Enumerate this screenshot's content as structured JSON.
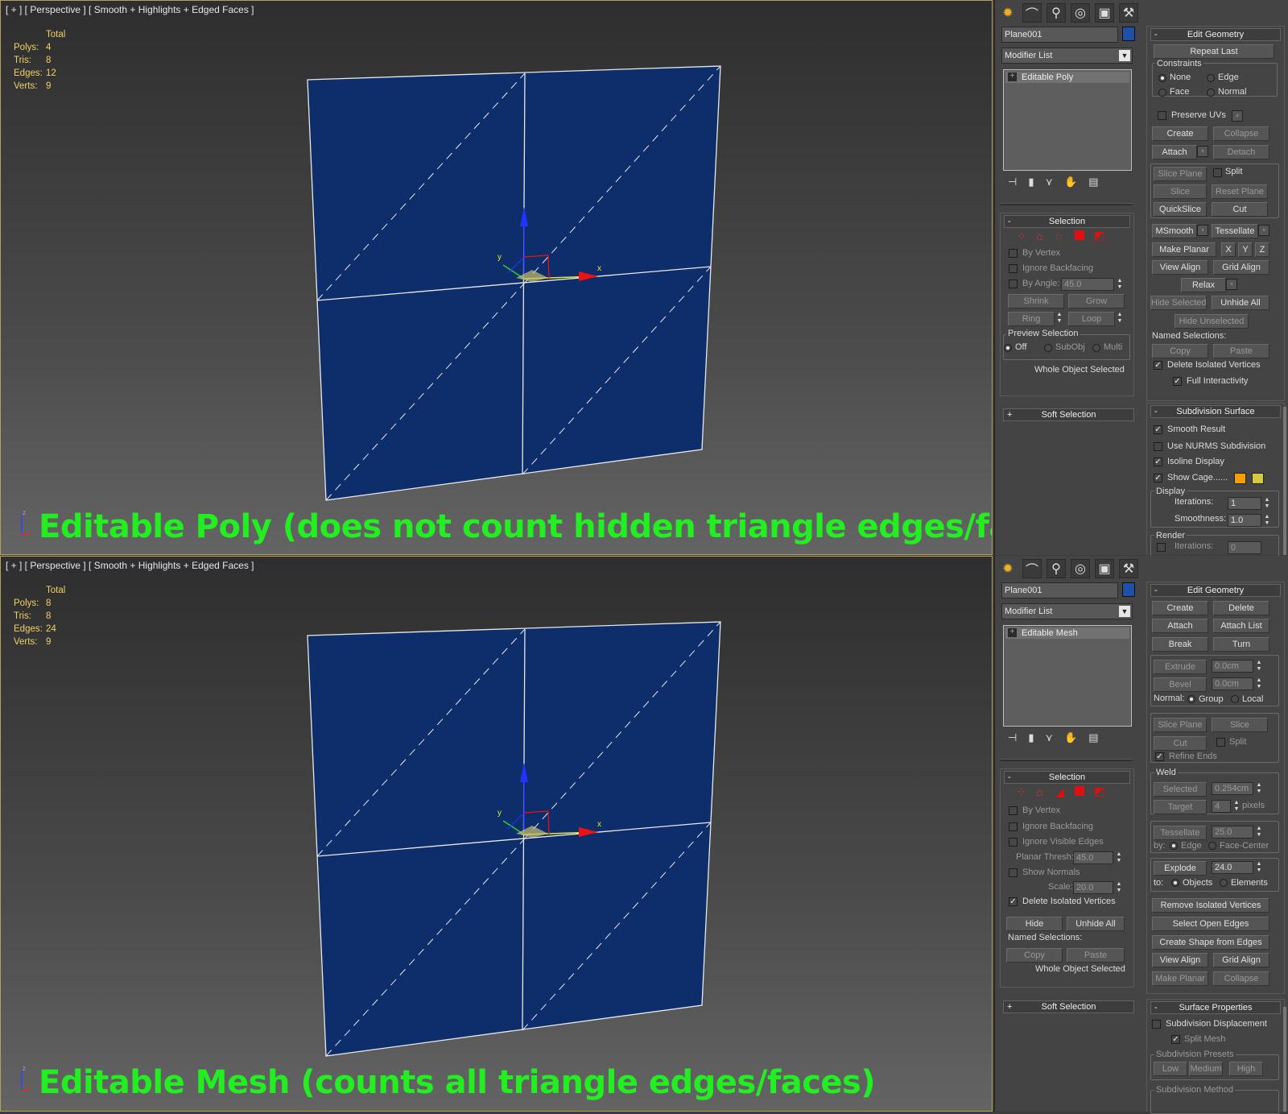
{
  "top": {
    "viewport_label": "[ + ] [ Perspective ] [ Smooth + Highlights + Edged Faces ]",
    "stats_header": "Total",
    "stats": [
      {
        "label": "Polys:",
        "value": "4"
      },
      {
        "label": "Tris:",
        "value": "8"
      },
      {
        "label": "Edges:",
        "value": "12"
      },
      {
        "label": "Verts:",
        "value": "9"
      }
    ],
    "gizmo": {
      "x": "x",
      "y": "y",
      "z": "z"
    },
    "caption": "Editable Poly (does not count hidden triangle edges/faces)",
    "object_name": "Plane001",
    "modifier_list": "Modifier List",
    "stack_item": "Editable Poly",
    "selection": {
      "title": "Selection",
      "by_vertex": "By Vertex",
      "ignore_backfacing": "Ignore Backfacing",
      "by_angle": "By Angle:",
      "angle_value": "45.0",
      "shrink": "Shrink",
      "grow": "Grow",
      "ring": "Ring",
      "loop": "Loop",
      "preview_selection": "Preview Selection",
      "off": "Off",
      "subobj": "SubObj",
      "multi": "Multi",
      "status": "Whole Object Selected"
    },
    "soft_selection": "Soft Selection",
    "edit_geometry": {
      "title": "Edit Geometry",
      "repeat_last": "Repeat Last",
      "constraints": "Constraints",
      "none": "None",
      "edge": "Edge",
      "face": "Face",
      "normal": "Normal",
      "preserve_uvs": "Preserve UVs",
      "create": "Create",
      "collapse": "Collapse",
      "attach": "Attach",
      "detach": "Detach",
      "slice_plane": "Slice Plane",
      "split": "Split",
      "slice": "Slice",
      "reset_plane": "Reset Plane",
      "quickslice": "QuickSlice",
      "cut": "Cut",
      "msmooth": "MSmooth",
      "tessellate": "Tessellate",
      "make_planar": "Make Planar",
      "x": "X",
      "y": "Y",
      "z": "Z",
      "view_align": "View Align",
      "grid_align": "Grid Align",
      "relax": "Relax",
      "hide_selected": "Hide Selected",
      "unhide_all": "Unhide All",
      "hide_unselected": "Hide Unselected",
      "named_selections": "Named Selections:",
      "copy": "Copy",
      "paste": "Paste",
      "delete_isolated": "Delete Isolated Vertices",
      "full_interactivity": "Full Interactivity"
    },
    "subdivision": {
      "title": "Subdivision Surface",
      "smooth_result": "Smooth Result",
      "use_nurms": "Use NURMS Subdivision",
      "isoline": "Isoline Display",
      "show_cage": "Show Cage......",
      "cage_color_1": "#f5a000",
      "cage_color_2": "#d4c840",
      "display": "Display",
      "iterations": "Iterations:",
      "iterations_value": "1",
      "smoothness": "Smoothness:",
      "smoothness_value": "1.0",
      "render": "Render",
      "render_iterations_value": "0"
    }
  },
  "bottom": {
    "viewport_label": "[ + ] [ Perspective ] [ Smooth + Highlights + Edged Faces ]",
    "stats_header": "Total",
    "stats": [
      {
        "label": "Polys:",
        "value": "8"
      },
      {
        "label": "Tris:",
        "value": "8"
      },
      {
        "label": "Edges:",
        "value": "24"
      },
      {
        "label": "Verts:",
        "value": "9"
      }
    ],
    "gizmo": {
      "x": "x",
      "y": "y",
      "z": "z"
    },
    "caption": "Editable Mesh (counts all triangle edges/faces)",
    "object_name": "Plane001",
    "modifier_list": "Modifier List",
    "stack_item": "Editable Mesh",
    "selection": {
      "title": "Selection",
      "by_vertex": "By Vertex",
      "ignore_backfacing": "Ignore Backfacing",
      "ignore_visible_edges": "Ignore Visible Edges",
      "planar_thresh": "Planar Thresh:",
      "planar_value": "45.0",
      "show_normals": "Show Normals",
      "scale": "Scale:",
      "scale_value": "20.0",
      "delete_isolated": "Delete Isolated Vertices",
      "hide": "Hide",
      "unhide_all": "Unhide All",
      "named_selections": "Named Selections:",
      "copy": "Copy",
      "paste": "Paste",
      "status": "Whole Object Selected"
    },
    "soft_selection": "Soft Selection",
    "edit_geometry": {
      "title": "Edit Geometry",
      "create": "Create",
      "delete": "Delete",
      "attach": "Attach",
      "attach_list": "Attach List",
      "break": "Break",
      "turn": "Turn",
      "extrude": "Extrude",
      "extrude_value": "0.0cm",
      "bevel": "Bevel",
      "bevel_value": "0.0cm",
      "normal": "Normal:",
      "group": "Group",
      "local": "Local",
      "slice_plane": "Slice Plane",
      "slice": "Slice",
      "cut": "Cut",
      "split": "Split",
      "refine_ends": "Refine Ends",
      "weld": "Weld",
      "selected": "Selected",
      "selected_value": "0.254cm",
      "target": "Target",
      "target_value": "4",
      "pixels": "pixels",
      "tessellate": "Tessellate",
      "tessellate_value": "25.0",
      "by": "by:",
      "edge": "Edge",
      "face_center": "Face-Center",
      "explode": "Explode",
      "explode_value": "24.0",
      "to": "to:",
      "objects": "Objects",
      "elements": "Elements",
      "remove_isolated": "Remove Isolated Vertices",
      "select_open_edges": "Select Open Edges",
      "create_shape": "Create Shape from Edges",
      "view_align": "View Align",
      "grid_align": "Grid Align",
      "make_planar": "Make Planar",
      "collapse": "Collapse"
    },
    "surface": {
      "title": "Surface Properties",
      "subdivision_displacement": "Subdivision Displacement",
      "split_mesh": "Split Mesh",
      "subdivision_presets": "Subdivision Presets",
      "low": "Low",
      "medium": "Medium",
      "high": "High",
      "subdivision_method": "Subdivision Method"
    }
  },
  "colors": {
    "plane_fill": "#0d2d6b",
    "caption": "#22ee22",
    "stats": "#f0d264"
  }
}
